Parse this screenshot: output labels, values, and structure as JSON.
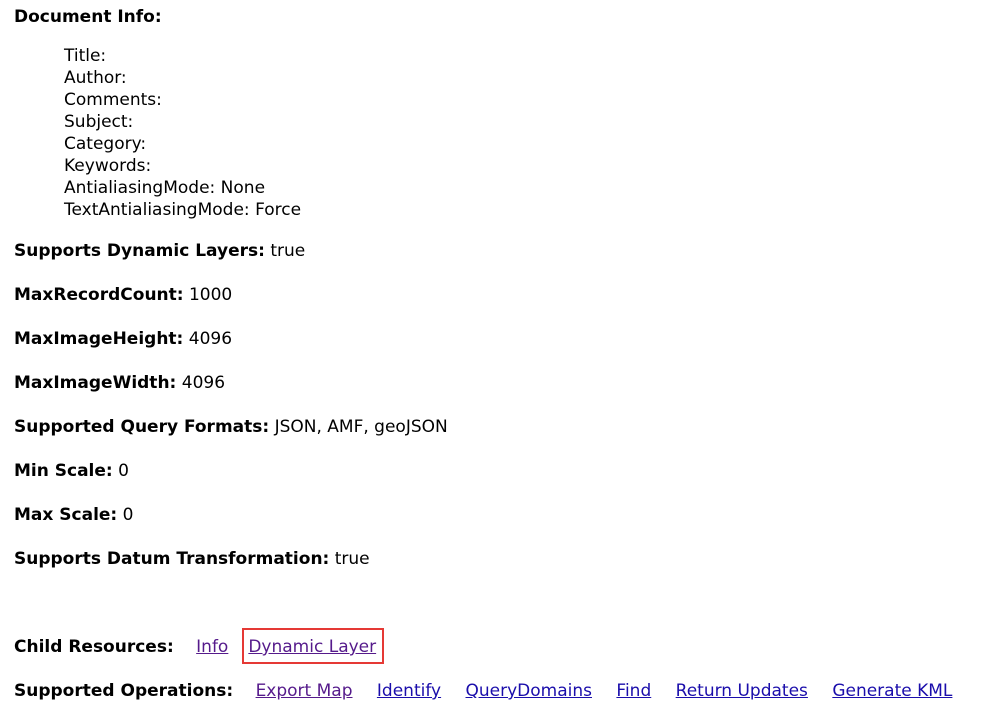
{
  "document_info": {
    "heading": "Document Info:",
    "fields": [
      {
        "label": "Title:",
        "value": ""
      },
      {
        "label": "Author:",
        "value": ""
      },
      {
        "label": "Comments:",
        "value": ""
      },
      {
        "label": "Subject:",
        "value": ""
      },
      {
        "label": "Category:",
        "value": ""
      },
      {
        "label": "Keywords:",
        "value": ""
      },
      {
        "label": "AntialiasingMode:",
        "value": "None"
      },
      {
        "label": "TextAntialiasingMode:",
        "value": "Force"
      }
    ]
  },
  "properties": [
    {
      "label": "Supports Dynamic Layers:",
      "value": "true"
    },
    {
      "label": "MaxRecordCount:",
      "value": "1000"
    },
    {
      "label": "MaxImageHeight:",
      "value": "4096"
    },
    {
      "label": "MaxImageWidth:",
      "value": "4096"
    },
    {
      "label": "Supported Query Formats:",
      "value": "JSON, AMF, geoJSON"
    },
    {
      "label": "Min Scale:",
      "value": "0"
    },
    {
      "label": "Max Scale:",
      "value": "0"
    },
    {
      "label": "Supports Datum Transformation:",
      "value": "true"
    }
  ],
  "child_resources": {
    "label": "Child Resources:",
    "links": [
      "Info",
      "Dynamic Layer"
    ]
  },
  "supported_operations": {
    "label": "Supported Operations:",
    "links": [
      "Export Map",
      "Identify",
      "QueryDomains",
      "Find",
      "Return Updates",
      "Generate KML"
    ]
  },
  "colors": {
    "link": "#1a0dab",
    "visited_link": "#551a8b",
    "highlight_border": "#e53935"
  }
}
